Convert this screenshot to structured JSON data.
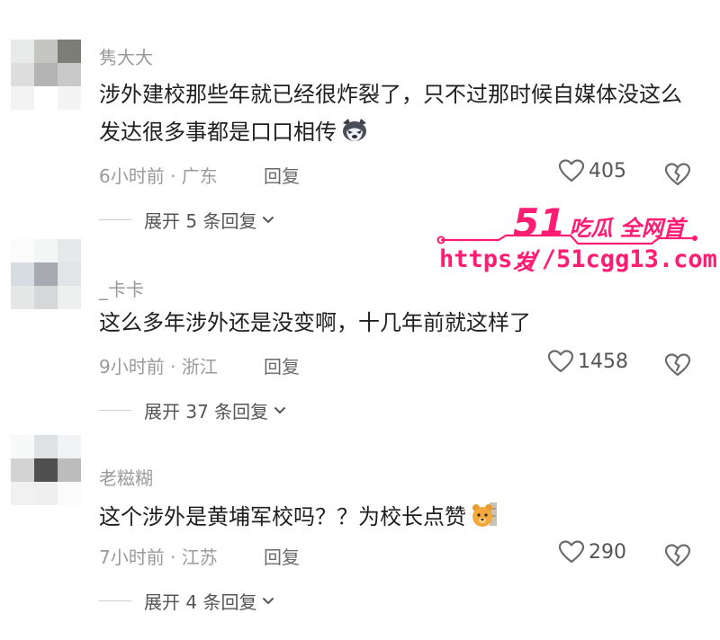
{
  "comments": [
    {
      "username": "隽大大",
      "text": "涉外建校那些年就已经很炸裂了，只不过那时候自媒体没这么发达很多事都是口口相传",
      "emoji": "husky-emoji",
      "time_location": "6小时前 · 广东",
      "reply_label": "回复",
      "likes": "405",
      "expand_label": "展开 5 条回复",
      "avatar_colors": [
        "#e8eaea",
        "#c5c6c2",
        "#7c7d75",
        "#dcdddc",
        "#b4b4b4",
        "#c9c9c9",
        "#f3f3f3",
        "#ffffff",
        "#f4f4f4"
      ]
    },
    {
      "username": "_卡卡",
      "text": "这么多年涉外还是没变啊，十几年前就这样了",
      "emoji": "",
      "time_location": "9小时前 · 浙江",
      "reply_label": "回复",
      "likes": "1458",
      "expand_label": "展开 37 条回复",
      "avatar_colors": [
        "#fbfbfb",
        "#f4f5f5",
        "#e6e8e9",
        "#d5dde2",
        "#a7aab0",
        "#e2e4e8",
        "#e5e7e7",
        "#d5d7d9",
        "#eef0f0"
      ]
    },
    {
      "username": "老糍糊",
      "text": "这个涉外是黄埔军校吗？？为校长点赞",
      "emoji": "bear-emoji",
      "time_location": "7小时前 · 江苏",
      "reply_label": "回复",
      "likes": "290",
      "expand_label": "展开 4 条回复",
      "avatar_colors": [
        "#f8f9f9",
        "#dee2e5",
        "#f1f3f4",
        "#d3d3d3",
        "#505050",
        "#bcbcbc",
        "#f1f1f1",
        "#efefef",
        "#fbfbfb"
      ]
    }
  ],
  "watermark": {
    "brand_number": "51",
    "brand_text": "吃瓜 全网首发",
    "url": "https://51cgg13.com",
    "color": "#ff1d73"
  }
}
